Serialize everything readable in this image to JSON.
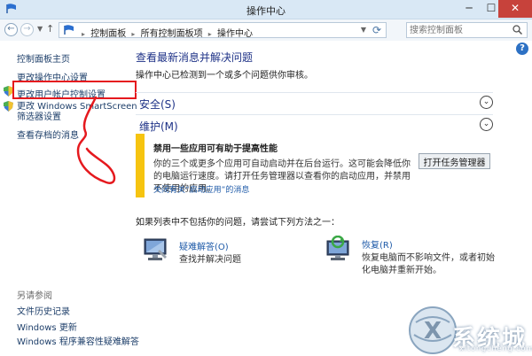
{
  "window": {
    "title": "操作中心",
    "min_label": "─",
    "max_label": "☐",
    "close_label": "✕"
  },
  "nav": {
    "back_label": "←",
    "forward_label": "→",
    "dropdown_label": "▼",
    "up_label": "↑",
    "breadcrumbs": [
      "控制面板",
      "所有控制面板项",
      "操作中心"
    ],
    "breadcrumb_sep": "▸",
    "address_drop_label": "▼",
    "refresh_label": "⟳",
    "search_placeholder": "搜索控制面板"
  },
  "help_label": "?",
  "sidebar": {
    "home": "控制面板主页",
    "change_settings": "更改操作中心设置",
    "change_uac": "更改用户帐户控制设置",
    "change_smartscreen_line1": "更改 Windows SmartScreen",
    "change_smartscreen_line2": "筛选器设置",
    "view_archived": "查看存档的消息",
    "see_also": "另请参阅",
    "file_history": "文件历史记录",
    "windows_update": "Windows 更新",
    "compat_troubleshooter": "Windows 程序兼容性疑难解答"
  },
  "main": {
    "title": "查看最新消息并解决问题",
    "subtitle": "操作中心已检测到一个或多个问题供你审核。",
    "security_label": "安全(S)",
    "maintenance_label": "维护(M)",
    "chevron_label": "⌄"
  },
  "alert": {
    "heading": "禁用一些应用可有助于提高性能",
    "body": "你的三个或更多个应用可自动启动并在后台运行。这可能会降低你的电脑运行速度。请打开任务管理器以查看你的启动应用，并禁用不使用的应用。",
    "link": "关闭有关“启动应用”的消息",
    "button": "打开任务管理器"
  },
  "issues": {
    "prompt": "如果列表中不包括你的问题，请尝试下列方法之一：",
    "troubleshoot_link": "疑难解答(O)",
    "troubleshoot_desc": "查找并解决问题",
    "recovery_link": "恢复(R)",
    "recovery_desc_line1": "恢复电脑而不影响文件，或者初始",
    "recovery_desc_line2": "化电脑并重新开始。"
  },
  "watermark": {
    "text": "系统城",
    "url": "xitongcheng.com"
  },
  "colors": {
    "annotation_red": "#e5191e",
    "alert_yellow": "#f6c410",
    "link_blue": "#1e5aa8",
    "heading_blue": "#1e3287",
    "titlebar": "#d9e8f5",
    "close_red": "#c7423b"
  }
}
